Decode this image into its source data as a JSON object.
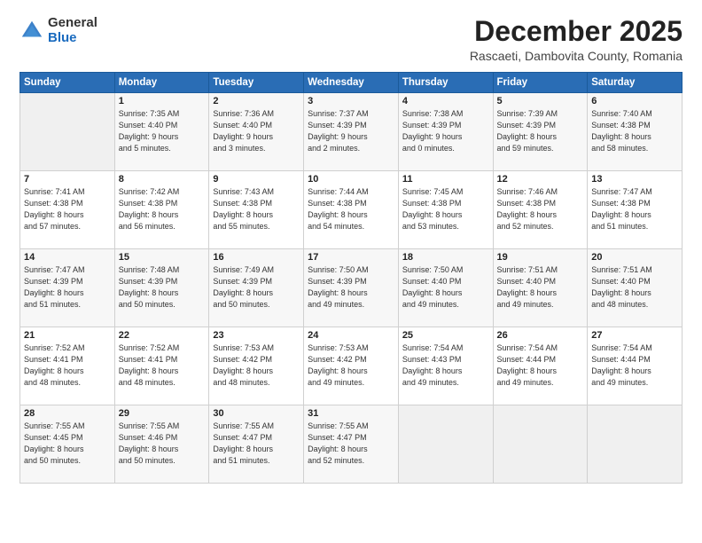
{
  "header": {
    "logo_general": "General",
    "logo_blue": "Blue",
    "month": "December 2025",
    "location": "Rascaeti, Dambovita County, Romania"
  },
  "days_of_week": [
    "Sunday",
    "Monday",
    "Tuesday",
    "Wednesday",
    "Thursday",
    "Friday",
    "Saturday"
  ],
  "weeks": [
    [
      {
        "day": "",
        "info": ""
      },
      {
        "day": "1",
        "info": "Sunrise: 7:35 AM\nSunset: 4:40 PM\nDaylight: 9 hours\nand 5 minutes."
      },
      {
        "day": "2",
        "info": "Sunrise: 7:36 AM\nSunset: 4:40 PM\nDaylight: 9 hours\nand 3 minutes."
      },
      {
        "day": "3",
        "info": "Sunrise: 7:37 AM\nSunset: 4:39 PM\nDaylight: 9 hours\nand 2 minutes."
      },
      {
        "day": "4",
        "info": "Sunrise: 7:38 AM\nSunset: 4:39 PM\nDaylight: 9 hours\nand 0 minutes."
      },
      {
        "day": "5",
        "info": "Sunrise: 7:39 AM\nSunset: 4:39 PM\nDaylight: 8 hours\nand 59 minutes."
      },
      {
        "day": "6",
        "info": "Sunrise: 7:40 AM\nSunset: 4:38 PM\nDaylight: 8 hours\nand 58 minutes."
      }
    ],
    [
      {
        "day": "7",
        "info": "Sunrise: 7:41 AM\nSunset: 4:38 PM\nDaylight: 8 hours\nand 57 minutes."
      },
      {
        "day": "8",
        "info": "Sunrise: 7:42 AM\nSunset: 4:38 PM\nDaylight: 8 hours\nand 56 minutes."
      },
      {
        "day": "9",
        "info": "Sunrise: 7:43 AM\nSunset: 4:38 PM\nDaylight: 8 hours\nand 55 minutes."
      },
      {
        "day": "10",
        "info": "Sunrise: 7:44 AM\nSunset: 4:38 PM\nDaylight: 8 hours\nand 54 minutes."
      },
      {
        "day": "11",
        "info": "Sunrise: 7:45 AM\nSunset: 4:38 PM\nDaylight: 8 hours\nand 53 minutes."
      },
      {
        "day": "12",
        "info": "Sunrise: 7:46 AM\nSunset: 4:38 PM\nDaylight: 8 hours\nand 52 minutes."
      },
      {
        "day": "13",
        "info": "Sunrise: 7:47 AM\nSunset: 4:38 PM\nDaylight: 8 hours\nand 51 minutes."
      }
    ],
    [
      {
        "day": "14",
        "info": "Sunrise: 7:47 AM\nSunset: 4:39 PM\nDaylight: 8 hours\nand 51 minutes."
      },
      {
        "day": "15",
        "info": "Sunrise: 7:48 AM\nSunset: 4:39 PM\nDaylight: 8 hours\nand 50 minutes."
      },
      {
        "day": "16",
        "info": "Sunrise: 7:49 AM\nSunset: 4:39 PM\nDaylight: 8 hours\nand 50 minutes."
      },
      {
        "day": "17",
        "info": "Sunrise: 7:50 AM\nSunset: 4:39 PM\nDaylight: 8 hours\nand 49 minutes."
      },
      {
        "day": "18",
        "info": "Sunrise: 7:50 AM\nSunset: 4:40 PM\nDaylight: 8 hours\nand 49 minutes."
      },
      {
        "day": "19",
        "info": "Sunrise: 7:51 AM\nSunset: 4:40 PM\nDaylight: 8 hours\nand 49 minutes."
      },
      {
        "day": "20",
        "info": "Sunrise: 7:51 AM\nSunset: 4:40 PM\nDaylight: 8 hours\nand 48 minutes."
      }
    ],
    [
      {
        "day": "21",
        "info": "Sunrise: 7:52 AM\nSunset: 4:41 PM\nDaylight: 8 hours\nand 48 minutes."
      },
      {
        "day": "22",
        "info": "Sunrise: 7:52 AM\nSunset: 4:41 PM\nDaylight: 8 hours\nand 48 minutes."
      },
      {
        "day": "23",
        "info": "Sunrise: 7:53 AM\nSunset: 4:42 PM\nDaylight: 8 hours\nand 48 minutes."
      },
      {
        "day": "24",
        "info": "Sunrise: 7:53 AM\nSunset: 4:42 PM\nDaylight: 8 hours\nand 49 minutes."
      },
      {
        "day": "25",
        "info": "Sunrise: 7:54 AM\nSunset: 4:43 PM\nDaylight: 8 hours\nand 49 minutes."
      },
      {
        "day": "26",
        "info": "Sunrise: 7:54 AM\nSunset: 4:44 PM\nDaylight: 8 hours\nand 49 minutes."
      },
      {
        "day": "27",
        "info": "Sunrise: 7:54 AM\nSunset: 4:44 PM\nDaylight: 8 hours\nand 49 minutes."
      }
    ],
    [
      {
        "day": "28",
        "info": "Sunrise: 7:55 AM\nSunset: 4:45 PM\nDaylight: 8 hours\nand 50 minutes."
      },
      {
        "day": "29",
        "info": "Sunrise: 7:55 AM\nSunset: 4:46 PM\nDaylight: 8 hours\nand 50 minutes."
      },
      {
        "day": "30",
        "info": "Sunrise: 7:55 AM\nSunset: 4:47 PM\nDaylight: 8 hours\nand 51 minutes."
      },
      {
        "day": "31",
        "info": "Sunrise: 7:55 AM\nSunset: 4:47 PM\nDaylight: 8 hours\nand 52 minutes."
      },
      {
        "day": "",
        "info": ""
      },
      {
        "day": "",
        "info": ""
      },
      {
        "day": "",
        "info": ""
      }
    ]
  ]
}
